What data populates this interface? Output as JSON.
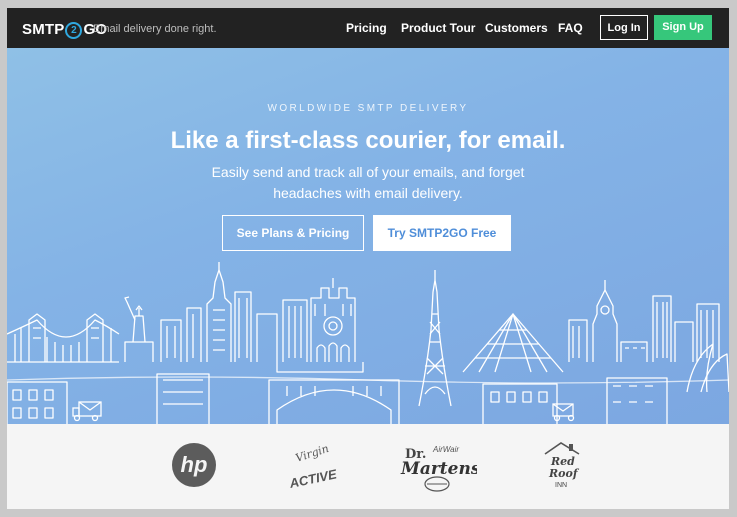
{
  "brand": {
    "name_left": "SMTP",
    "name_mid": "2",
    "name_right": "GO",
    "tagline": "Email delivery done right."
  },
  "nav": {
    "items": [
      "Pricing",
      "Product Tour",
      "Customers",
      "FAQ"
    ],
    "login_label": "Log In",
    "signup_label": "Sign Up"
  },
  "hero": {
    "eyebrow": "WORLDWIDE SMTP DELIVERY",
    "headline": "Like a first-class courier, for email.",
    "subtitle_line1": "Easily send and track all of your emails, and forget",
    "subtitle_line2": "headaches with email delivery.",
    "cta_plans": "See Plans & Pricing",
    "cta_try": "Try SMTP2GO Free"
  },
  "customers": {
    "hp": "hp",
    "virgin": "Virgin",
    "active": "ACTIVE",
    "drm_top": "Dr.",
    "drm_air": "AirWair",
    "drm_main": "Martens",
    "rr_1": "Red",
    "rr_2": "Roof",
    "rr_3": "INN"
  },
  "colors": {
    "nav_bg": "#222222",
    "accent_green": "#36c77b",
    "hero_blue": "#84b3e6",
    "logo_circle": "#2fa8df"
  },
  "icons": [
    "envelope-icon"
  ]
}
